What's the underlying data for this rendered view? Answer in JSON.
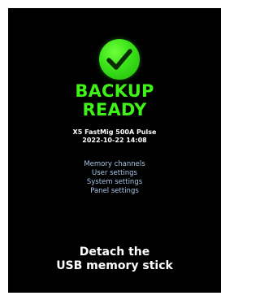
{
  "status": {
    "icon": "check-circle-icon",
    "line1": "BACKUP",
    "line2": "READY",
    "color": "#3ff218"
  },
  "device": {
    "model": "X5 FastMig 500A Pulse",
    "datetime": "2022-10-22 14:08"
  },
  "backup_items": [
    "Memory channels",
    "User settings",
    "System settings",
    "Panel settings"
  ],
  "instruction": {
    "line1": "Detach the",
    "line2": "USB memory stick"
  }
}
